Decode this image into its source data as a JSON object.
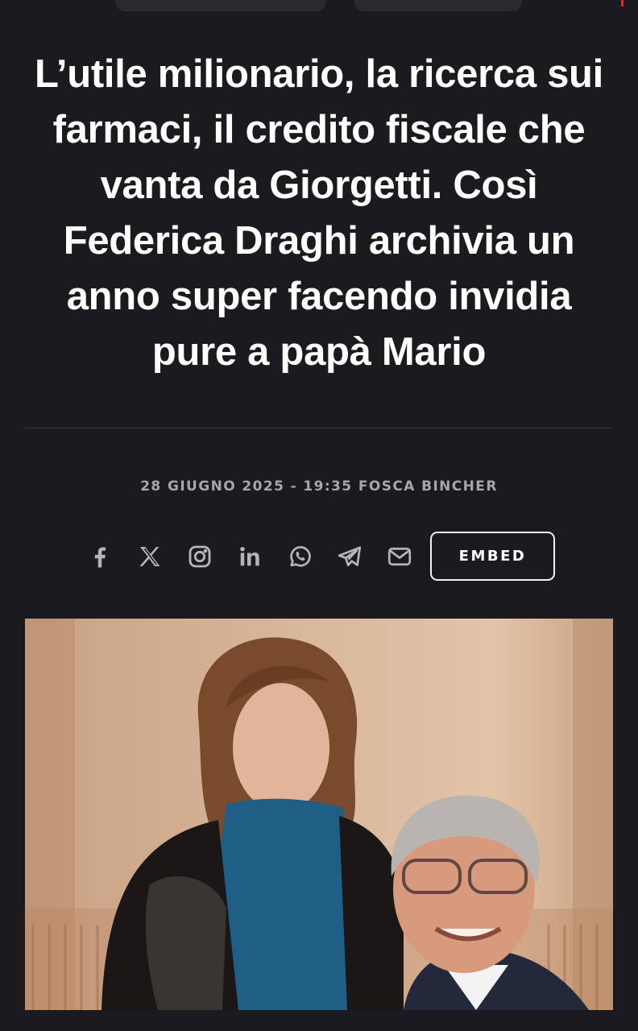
{
  "article": {
    "title": "L’utile milionario, la ricerca sui farmaci, il credito fiscale che vanta da Giorgetti. Così Federica Draghi archivia un anno super facendo invidia pure a papà Mario",
    "byline": "28 GIUGNO 2025 - 19:35 FOSCA BINCHER",
    "embed_label": "EMBED"
  },
  "share": {
    "icons": [
      "facebook-icon",
      "x-icon",
      "instagram-icon",
      "linkedin-icon",
      "whatsapp-icon",
      "telegram-icon",
      "email-icon"
    ]
  },
  "colors": {
    "background": "#1b1a1f",
    "text": "#ffffff",
    "meta": "#a7a6ad",
    "icon": "#b5b4ba",
    "accent": "#e3262b"
  }
}
